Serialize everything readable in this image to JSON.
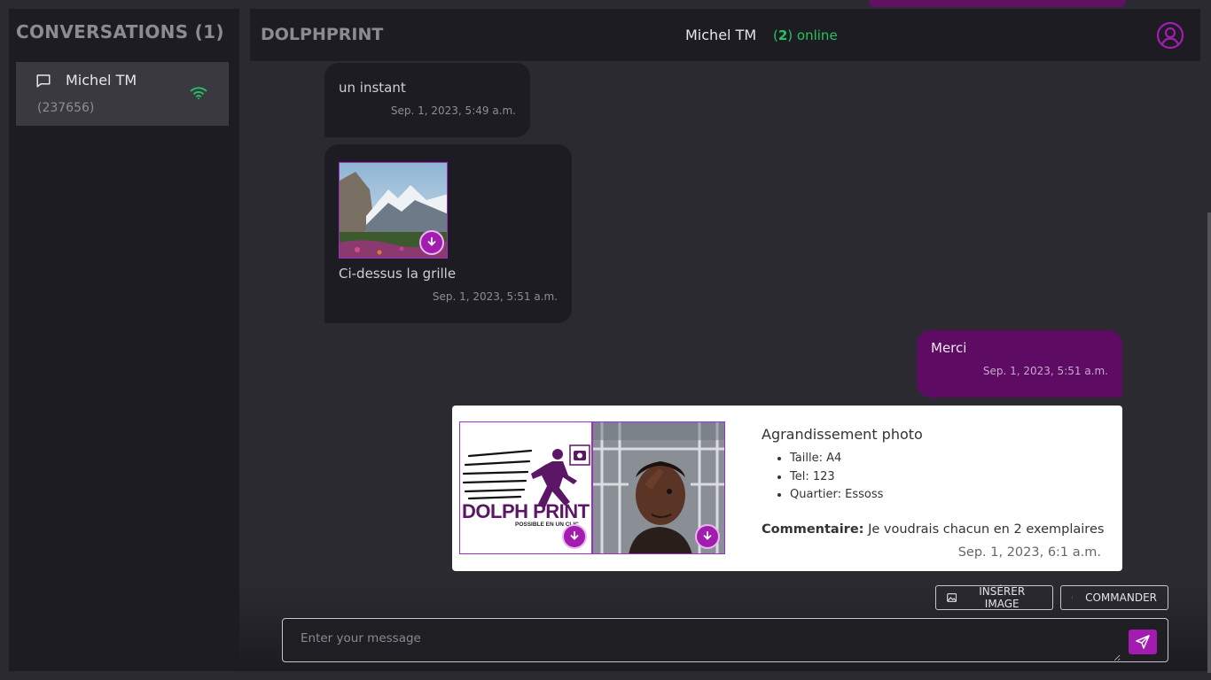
{
  "sidebar": {
    "title": "CONVERSATIONS (1)",
    "conversations": [
      {
        "name": "Michel TM",
        "id": "(237656)",
        "status_icon": "wifi-icon"
      }
    ]
  },
  "header": {
    "brand": "DOLPHPRINT",
    "peer_name": "Michel TM",
    "online_open": "(",
    "online_count": "2",
    "online_close": ") online",
    "user_icon": "user-circle-icon"
  },
  "messages": [
    {
      "text": "un instant",
      "timestamp": "Sep. 1, 2023, 5:49 a.m.",
      "side": "received"
    },
    {
      "text": "Ci-dessus la grille",
      "timestamp": "Sep. 1, 2023, 5:51 a.m.",
      "side": "received",
      "has_image": true
    },
    {
      "text": "Merci",
      "timestamp": "Sep. 1, 2023, 5:51 a.m.",
      "side": "sent"
    }
  ],
  "order": {
    "title": "Agrandissement photo",
    "details": [
      "Taille: A4",
      "Tel: 123",
      "Quartier: Essoss"
    ],
    "comment_label": "Commentaire:",
    "comment_text": "Je voudrais chacun en 2 exemplaires",
    "timestamp": "Sep. 1, 2023, 6:1 a.m.",
    "logo_text": "DOLPH PRINT",
    "logo_tagline": "POSSIBLE EN UN CLIC"
  },
  "composer": {
    "insert_image_label": "INSÉRER IMAGE",
    "order_label": "COMMANDER",
    "placeholder": "Enter your message"
  },
  "colors": {
    "accent": "#a21caf",
    "sent_bubble": "#5e0b63",
    "online": "#22c55e",
    "panel": "#1d1c22",
    "background": "#2b2a31"
  }
}
